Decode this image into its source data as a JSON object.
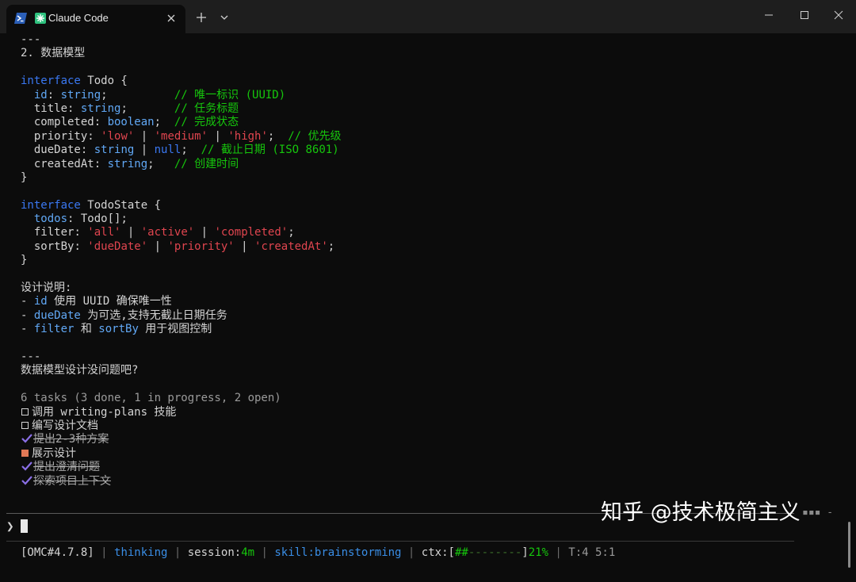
{
  "window": {
    "tab_title": "Claude Code",
    "colors": {
      "background": "#0c0c0c",
      "titlebar": "#1e1e1e",
      "accent": "#16c60c"
    }
  },
  "doc": {
    "sep1": "---",
    "heading": "2. 数据模型",
    "todo_interface": {
      "kw": "interface",
      "name": " Todo {",
      "fields": [
        {
          "name": "id",
          "colon": ": ",
          "type": "string",
          "semi": ";          ",
          "comment": "// 唯一标识 (UUID)"
        },
        {
          "name": "title",
          "colon": ": ",
          "type": "string",
          "semi": ";       ",
          "comment": "// 任务标题"
        },
        {
          "name": "completed",
          "colon": ": ",
          "type": "boolean",
          "semi": ";  ",
          "comment": "// 完成状态"
        }
      ],
      "priority": {
        "name": "priority",
        "colon": ": ",
        "v1": "'low'",
        "p1": " | ",
        "v2": "'medium'",
        "p2": " | ",
        "v3": "'high'",
        "semi": ";  ",
        "comment": "// 优先级"
      },
      "dueDate": {
        "name": "dueDate",
        "colon": ": ",
        "type": "string",
        "pipe": " | ",
        "null": "null",
        "semi": ";  ",
        "comment": "// 截止日期 (ISO 8601)"
      },
      "createdAt": {
        "name": "createdAt",
        "colon": ": ",
        "type": "string",
        "semi": ";   ",
        "comment": "// 创建时间"
      },
      "close": "}"
    },
    "state_interface": {
      "kw": "interface",
      "name": " TodoState {",
      "todos": {
        "name": "todos",
        "rest": ": Todo[];"
      },
      "filter": {
        "name": "filter",
        "colon": ": ",
        "v1": "'all'",
        "p1": " | ",
        "v2": "'active'",
        "p2": " | ",
        "v3": "'completed'",
        "semi": ";"
      },
      "sortBy": {
        "name": "sortBy",
        "colon": ": ",
        "v1": "'dueDate'",
        "p1": " | ",
        "v2": "'priority'",
        "p2": " | ",
        "v3": "'createdAt'",
        "semi": ";"
      },
      "close": "}"
    },
    "notes": {
      "title": "设计说明:",
      "items": [
        {
          "dash": "- ",
          "code": "id",
          "text": " 使用 UUID 确保唯一性"
        },
        {
          "dash": "- ",
          "code": "dueDate",
          "text": " 为可选,支持无截止日期任务"
        },
        {
          "dash": "- ",
          "code": "filter",
          "mid": " 和 ",
          "code2": "sortBy",
          "text": " 用于视图控制"
        }
      ]
    },
    "sep2": "---",
    "question": "数据模型设计没问题吧?"
  },
  "tasks": {
    "summary": "6 tasks (3 done, 1 in progress, 2 open)",
    "items": [
      {
        "label": "调用 writing-plans 技能",
        "status": "open"
      },
      {
        "label": "编写设计文档",
        "status": "open"
      },
      {
        "label": "提出2-3种方案",
        "status": "done"
      },
      {
        "label": "展示设计",
        "status": "in_progress"
      },
      {
        "label": "提出澄清问题",
        "status": "done"
      },
      {
        "label": "探索项目上下文",
        "status": "done"
      }
    ]
  },
  "prompt": {
    "chevron": "❯",
    "dots": "▪▪▪ -"
  },
  "status": {
    "omc": "[OMC#4.7.8]",
    "sep": " | ",
    "thinking": "thinking",
    "session_label": "session:",
    "session_value": "4m",
    "skill": "skill:brainstorming",
    "ctx_label": "ctx:[",
    "ctx_fill": "##",
    "ctx_empty": "--------",
    "ctx_close": "]",
    "ctx_pct": "21%",
    "tail": "T:",
    "tail_value": "4 5:1",
    "ctx_fraction": 0.21
  },
  "watermark": "知乎 @技术极简主义"
}
